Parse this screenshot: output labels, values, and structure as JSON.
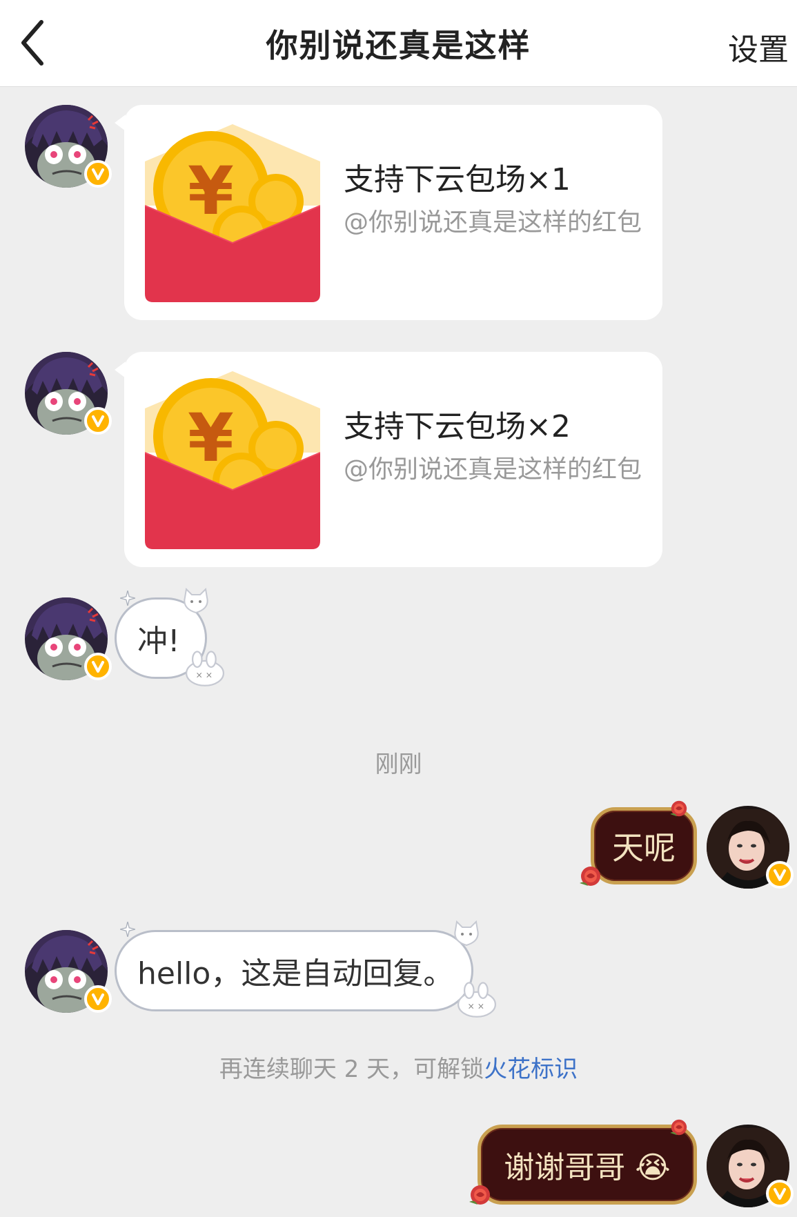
{
  "header": {
    "title": "你别说还真是这样",
    "settings_label": "设置",
    "back_icon": "chevron-left-icon"
  },
  "messages": [
    {
      "type": "red_packet",
      "from": "other",
      "title": "支持下云包场×1",
      "subtitle": "@你别说还真是这样的红包"
    },
    {
      "type": "red_packet",
      "from": "other",
      "title": "支持下云包场×2",
      "subtitle": "@你别说还真是这样的红包"
    },
    {
      "type": "text",
      "from": "other",
      "text": "冲!"
    },
    {
      "type": "time",
      "text": "刚刚"
    },
    {
      "type": "text",
      "from": "me",
      "text": "天呢"
    },
    {
      "type": "text",
      "from": "other",
      "text": "hello，这是自动回复。"
    },
    {
      "type": "system",
      "text": "再连续聊天 2 天，可解锁",
      "link": "火花标识"
    },
    {
      "type": "text",
      "from": "me",
      "text": "谢谢哥哥",
      "emoji": "😭"
    }
  ],
  "colors": {
    "packet_red": "#e2344c",
    "coin_gold": "#f8b800",
    "link_blue": "#3d72c8",
    "verified_badge": "#ffb300",
    "rose_bubble_bg": "#3d1010",
    "rose_bubble_border": "#c9a050"
  }
}
